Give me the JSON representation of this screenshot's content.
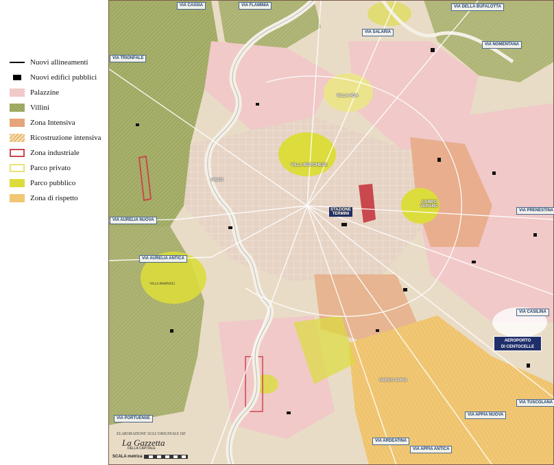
{
  "legend": {
    "items": [
      {
        "label": "Nuovi allineamenti",
        "style": "line",
        "color": "#000000"
      },
      {
        "label": "Nuovi edifici pubblici",
        "style": "block",
        "color": "#000000"
      },
      {
        "label": "Palazzine",
        "style": "fill",
        "color": "#f0c9c8"
      },
      {
        "label": "Villini",
        "style": "fill",
        "color": "#a7b06a"
      },
      {
        "label": "Zona Intensiva",
        "style": "fill",
        "color": "#e6a47b"
      },
      {
        "label": "Ricostruzione intensiva",
        "style": "hatch",
        "color": "#e9b96e"
      },
      {
        "label": "Zona industriale",
        "style": "outline",
        "color": "#c9484d"
      },
      {
        "label": "Parco privato",
        "style": "outline",
        "color": "#e9e27a"
      },
      {
        "label": "Parco pubblico",
        "style": "fill",
        "color": "#dcdc3c"
      },
      {
        "label": "Zona di rispetto",
        "style": "fill",
        "color": "#f1c774"
      }
    ]
  },
  "map": {
    "road_labels": {
      "via_cassia": "VIA CASSIA",
      "via_flaminia": "VIA FLAMINIA",
      "via_salaria": "VIA SALARIA",
      "via_bufalotta": "VIA DELLA BUFALOTTA",
      "via_nomentana": "VIA NOMENTANA",
      "via_trionfale": "VIA TRIONFALE",
      "via_aurelia_nuova": "VIA AURELIA NUOVA",
      "via_aurelia_antica": "VIA AURELIA ANTICA",
      "via_prenestina": "VIA PRENESTINA",
      "via_casilina": "VIA CASILINA",
      "via_tuscolana": "VIA TUSCOLANA",
      "via_appia_nuova": "VIA APPIA NUOVA",
      "via_portuense": "VIA PORTUENSE",
      "via_ardeatina": "VIA ARDEATINA",
      "via_appia_antica": "VIA APPIA ANTICA"
    },
    "place_labels": {
      "villa_ada": "VILLA ADA",
      "villa_borghese": "VILLA BORGHESE",
      "prati": "PRATI",
      "stazione_termini": "STAZIONE\nTERMINI",
      "campo_verano": "CAMPO\nVERANO",
      "villa_pamphili": "VILLA PAMPHILI",
      "parco_appia": "PARCO APPIA"
    },
    "airport": "AEROPORTO\nDI CENTOCELLE",
    "credit": "ELABORAZIONE SULL'ORIGINALE DE",
    "logo": "La Gazzetta",
    "logo_sub": "DELLA CAPITALE",
    "scale_label": "SCALA metrica",
    "colors": {
      "base": "#e9dcc6",
      "villini": "#a7b06a",
      "palazzine": "#f0c9c8",
      "intensiva": "#e6a47b",
      "parco_pubblico": "#dcdc3c",
      "rispetto": "#f1c774",
      "river": "#f5f0e6",
      "industrial": "#c9484d"
    }
  }
}
